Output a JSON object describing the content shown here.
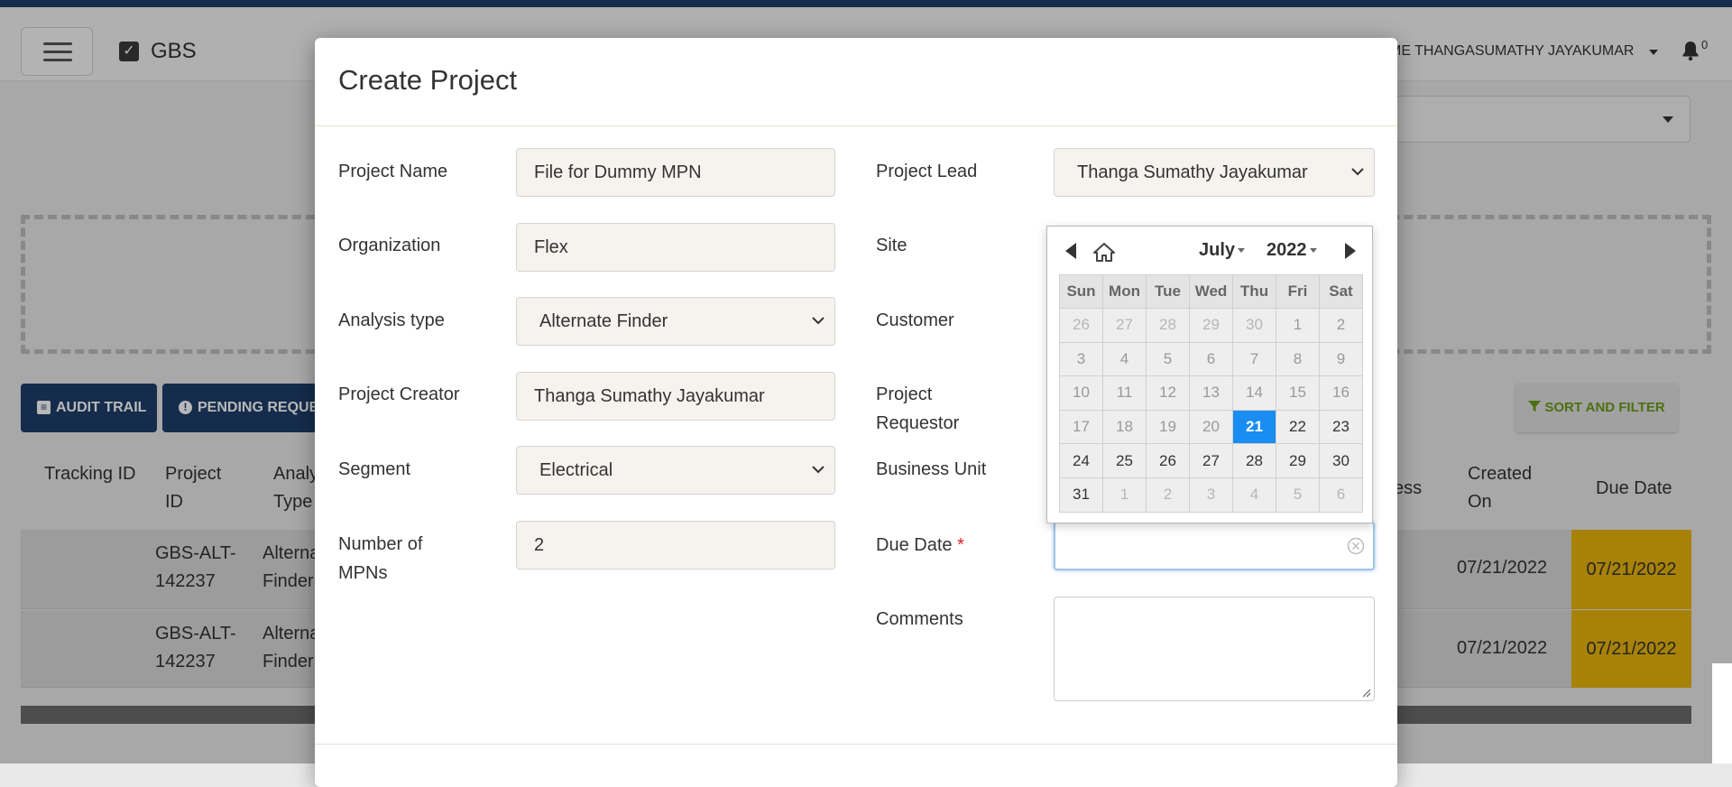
{
  "app": {
    "brand": "GBS",
    "user_name": "ME THANGASUMATHY JAYAKUMAR",
    "notification_count": "0"
  },
  "toolbar": {
    "audit_trail": "AUDIT TRAIL",
    "pending_requests": "PENDING REQUES",
    "sort_filter": "SORT AND FILTER"
  },
  "table": {
    "headers": {
      "tracking_id": "Tracking ID",
      "project_id": "Project ID",
      "analysis_type": "Analy Type",
      "status": "ess",
      "created_on": "Created On",
      "due_date": "Due Date"
    },
    "rows": [
      {
        "project_id": "GBS-ALT-142237",
        "analysis_type": "Alterna Finder",
        "created_on": "07/21/2022",
        "due_date": "07/21/2022"
      },
      {
        "project_id": "GBS-ALT-142237",
        "analysis_type": "Alterna Finder",
        "created_on": "07/21/2022",
        "due_date": "07/21/2022"
      }
    ]
  },
  "modal": {
    "title": "Create Project",
    "labels": {
      "project_name": "Project Name",
      "organization": "Organization",
      "analysis_type": "Analysis type",
      "project_creator": "Project Creator",
      "segment": "Segment",
      "number_of_mpns": "Number of MPNs",
      "project_lead": "Project Lead",
      "site": "Site",
      "customer": "Customer",
      "project_requestor": "Project Requestor",
      "business_unit": "Business Unit",
      "due_date": "Due Date",
      "required_mark": "*",
      "comments": "Comments"
    },
    "values": {
      "project_name": "File for Dummy MPN",
      "organization": "Flex",
      "analysis_type": "Alternate Finder",
      "project_creator": "Thanga Sumathy Jayakumar",
      "segment": "Electrical",
      "number_of_mpns": "2",
      "project_lead": "Thanga Sumathy Jayakumar",
      "due_date": "",
      "comments": ""
    }
  },
  "datepicker": {
    "month": "July",
    "year": "2022",
    "weekdays": [
      "Sun",
      "Mon",
      "Tue",
      "Wed",
      "Thu",
      "Fri",
      "Sat"
    ],
    "today": "21",
    "weeks": [
      [
        "26",
        "27",
        "28",
        "29",
        "30",
        "1",
        "2"
      ],
      [
        "3",
        "4",
        "5",
        "6",
        "7",
        "8",
        "9"
      ],
      [
        "10",
        "11",
        "12",
        "13",
        "14",
        "15",
        "16"
      ],
      [
        "17",
        "18",
        "19",
        "20",
        "21",
        "22",
        "23"
      ],
      [
        "24",
        "25",
        "26",
        "27",
        "28",
        "29",
        "30"
      ],
      [
        "31",
        "1",
        "2",
        "3",
        "4",
        "5",
        "6"
      ]
    ],
    "colors": {
      "today": "#1a8df2"
    }
  },
  "colors": {
    "navy": "#1e3e6a",
    "due_highlight": "#e8b409",
    "sort_text": "#6a9b1b"
  }
}
